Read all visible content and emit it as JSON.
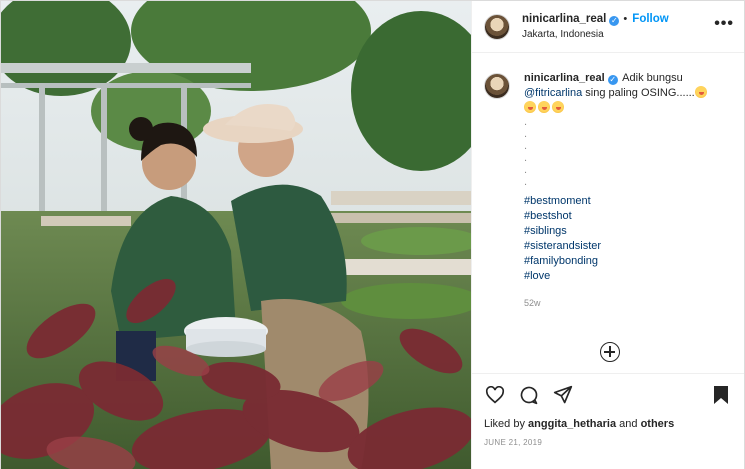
{
  "post": {
    "username": "ninicarlina_real",
    "verified_glyph": "✓",
    "separator": "•",
    "follow_label": "Follow",
    "location": "Jakarta, Indonesia",
    "more_icon": "more-horizontal-icon"
  },
  "caption": {
    "username": "ninicarlina_real",
    "text_part1": "Adik bungsu",
    "mention": "@fitricarlina",
    "text_part2": "sing paling OSING......",
    "dots": [
      ".",
      ".",
      ".",
      ".",
      ".",
      "."
    ],
    "hashtags": [
      "#bestmoment",
      "#bestshot",
      "#siblings",
      "#sisterandsister",
      "#familybonding",
      "#love"
    ],
    "age": "52w"
  },
  "actions": {
    "icons": [
      "heart-icon",
      "comment-icon",
      "share-icon",
      "bookmark-icon"
    ],
    "liked_by_prefix": "Liked by",
    "liked_by_user": "anggita_hetharia",
    "liked_by_and": "and",
    "liked_by_others": "others",
    "date": "JUNE 21, 2019"
  },
  "colors": {
    "link": "#00376b",
    "follow": "#0095f6",
    "verified": "#3897f0",
    "muted": "#8e8e8e"
  }
}
